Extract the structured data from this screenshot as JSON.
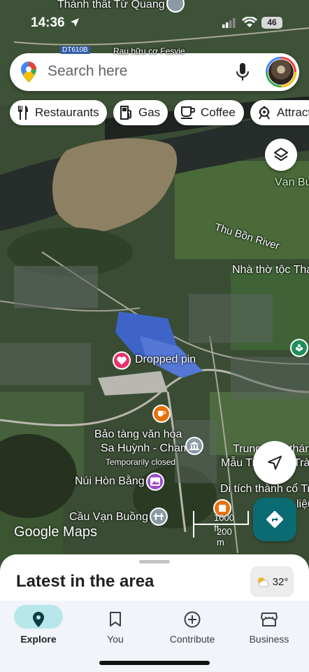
{
  "status": {
    "time": "14:36",
    "battery": "46"
  },
  "search": {
    "placeholder": "Search here"
  },
  "chips": [
    {
      "label": "Restaurants",
      "icon": "fork-knife-icon"
    },
    {
      "label": "Gas",
      "icon": "gas-pump-icon"
    },
    {
      "label": "Coffee",
      "icon": "coffee-cup-icon"
    },
    {
      "label": "Attract",
      "icon": "attractions-icon"
    }
  ],
  "map": {
    "labels": {
      "top_place": "Thánh thất Từ Quang",
      "road_badge": "DT610B",
      "top_street": "Rau hữu cơ Fesvie",
      "van_bu": "Vạn Bu",
      "river": "Thu Bồn River",
      "church": "Nhà thờ tộc Thá",
      "dropped_pin": "Dropped pin",
      "museum_line1": "Bảo tàng văn hóa",
      "museum_line2": "Sa Huỳnh - Champa",
      "museum_status": "Temporarily closed",
      "trung_line1": "Trung",
      "trung_line2": "Mẫu Tr",
      "trung_right1": "thán",
      "trung_right2": "Trà",
      "mountain": "Núi Hòn Bằng",
      "relic": "Di tích thành cổ Tr",
      "relic_right": "liệu",
      "bridge": "Cầu Vạn Buồng"
    },
    "scale_ft": "1000 ft",
    "scale_m": "200 m",
    "watermark": "Google Maps",
    "colors": {
      "map_base": "#3a4d34",
      "river": "#2a2e2b",
      "pin": "#e8336d",
      "poi_orange": "#e8710a",
      "poi_gray": "#8a9aa6",
      "poi_purple": "#9c4dcc",
      "accent": "#0b6b73"
    }
  },
  "sheet": {
    "title": "Latest in the area",
    "temperature": "32°"
  },
  "nav": [
    {
      "label": "Explore",
      "icon": "explore-pin-icon",
      "active": true
    },
    {
      "label": "You",
      "icon": "bookmark-icon",
      "active": false
    },
    {
      "label": "Contribute",
      "icon": "plus-circle-icon",
      "active": false
    },
    {
      "label": "Business",
      "icon": "storefront-icon",
      "active": false
    }
  ]
}
